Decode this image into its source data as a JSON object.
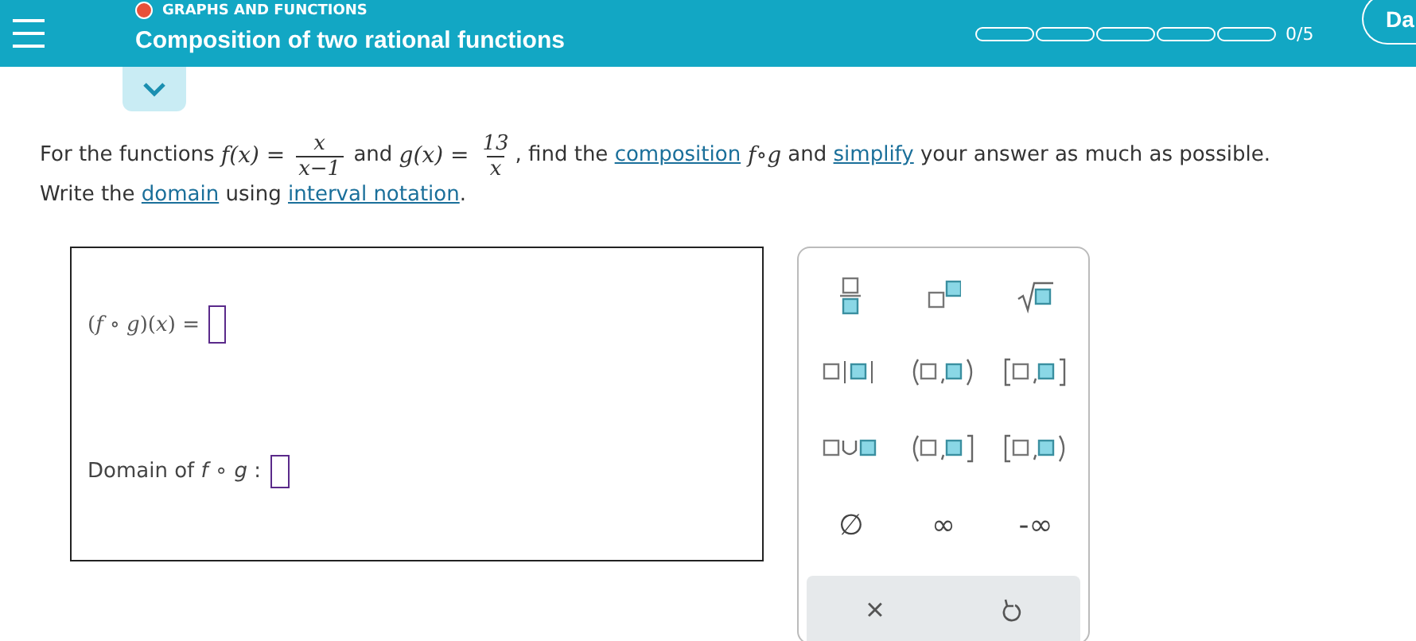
{
  "header": {
    "category": "GRAPHS AND FUNCTIONS",
    "title": "Composition of two rational functions",
    "progress": {
      "segments": [
        {
          "filled": false
        },
        {
          "filled": false
        },
        {
          "filled": false
        },
        {
          "filled": false
        },
        {
          "filled": false
        }
      ],
      "count": "0/5"
    },
    "right_button": "Da"
  },
  "problem": {
    "line_1": [
      {
        "kind": "text",
        "text": "For the functions "
      },
      {
        "kind": "math",
        "text": "f(x) = "
      },
      {
        "kind": "fraction",
        "numerator": "x",
        "denominator": "x−1"
      },
      {
        "kind": "text",
        "text": " and "
      },
      {
        "kind": "math",
        "text": "g(x) = "
      },
      {
        "kind": "fraction",
        "numerator": "13",
        "denominator": "x"
      },
      {
        "kind": "text",
        "text": ", find the "
      },
      {
        "kind": "link",
        "text": "composition"
      },
      {
        "kind": "math",
        "text": " f∘g"
      },
      {
        "kind": "text",
        "text": " and "
      },
      {
        "kind": "link",
        "text": "simplify"
      },
      {
        "kind": "text",
        "text": " your answer as much as possible."
      }
    ],
    "line_2": [
      {
        "kind": "text",
        "text": "Write the "
      },
      {
        "kind": "link",
        "text": "domain"
      },
      {
        "kind": "text",
        "text": " using "
      },
      {
        "kind": "link",
        "text": "interval notation"
      },
      {
        "kind": "text",
        "text": "."
      }
    ]
  },
  "answer": {
    "composition_label": "(*f* ∘ *g*)(*x*) =",
    "domain_label": "Domain of *f* ∘ *g* :"
  },
  "keypad": {
    "keys": [
      {
        "kind": "fraction"
      },
      {
        "kind": "superscript"
      },
      {
        "kind": "sqrt"
      },
      {
        "kind": "abs"
      },
      {
        "kind": "open-interval"
      },
      {
        "kind": "closed-interval"
      },
      {
        "kind": "union"
      },
      {
        "kind": "left-open"
      },
      {
        "kind": "right-open"
      },
      {
        "kind": "text",
        "label": "∅"
      },
      {
        "kind": "text",
        "label": "∞"
      },
      {
        "kind": "text",
        "label": "-∞"
      }
    ],
    "actions": [
      {
        "kind": "clear",
        "label": "×"
      },
      {
        "kind": "undo"
      }
    ]
  }
}
